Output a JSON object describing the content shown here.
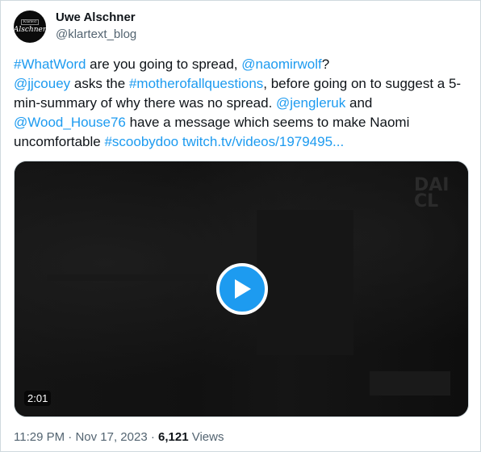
{
  "author": {
    "name": "Uwe Alschner",
    "handle": "@klartext_blog",
    "avatar_text_top": "Klartext",
    "avatar_text_signature": "Alschner"
  },
  "tweet": {
    "line1": [
      {
        "t": "#WhatWord",
        "link": true
      },
      {
        "t": " are you going to spread, ",
        "link": false
      },
      {
        "t": "@naomirwolf",
        "link": true
      },
      {
        "t": "?",
        "link": false
      }
    ],
    "line2": [
      {
        "t": "@jjcouey",
        "link": true
      },
      {
        "t": " asks the ",
        "link": false
      },
      {
        "t": "#motherofallquestions",
        "link": true
      },
      {
        "t": ", before going on to suggest a 5-min-summary of why there was no spread. ",
        "link": false
      },
      {
        "t": "@jengleruk",
        "link": true
      },
      {
        "t": " and ",
        "link": false
      },
      {
        "t": "@Wood_House76",
        "link": true
      },
      {
        "t": " have a message which seems to make Naomi uncomfortable ",
        "link": false
      },
      {
        "t": "#scoobydoo",
        "link": true
      },
      {
        "t": "  ",
        "link": false
      },
      {
        "t": "twitch.tv/videos/1979495...",
        "link": true
      }
    ]
  },
  "media": {
    "duration": "2:01",
    "play_icon": "play-icon"
  },
  "footer": {
    "time": "11:29 PM",
    "sep1": " · ",
    "date": "Nov 17, 2023",
    "sep2": " · ",
    "views_count": "6,121",
    "views_label": " Views"
  },
  "colors": {
    "link": "#1d9bf0",
    "text": "#0f1419",
    "secondary": "#536471"
  }
}
